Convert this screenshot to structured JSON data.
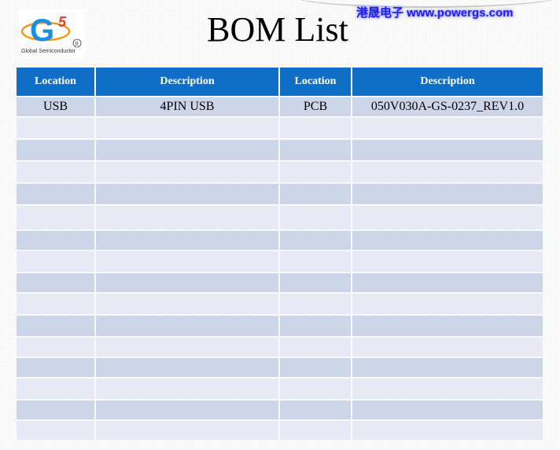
{
  "header": {
    "logo": {
      "mark": "G5",
      "caption": "Global Semiconductor",
      "registered": "®"
    },
    "title": "BOM List",
    "brand_text": "港晟电子 www.powergs.com"
  },
  "table": {
    "columns": [
      "Location",
      "Description",
      "Location",
      "Description"
    ],
    "rows": [
      [
        "USB",
        "4PIN USB",
        "PCB",
        "050V030A-GS-0237_REV1.0"
      ],
      [
        "",
        "",
        "",
        ""
      ],
      [
        "",
        "",
        "",
        ""
      ],
      [
        "",
        "",
        "",
        ""
      ],
      [
        "",
        "",
        "",
        ""
      ],
      [
        "",
        "",
        "",
        ""
      ],
      [
        "",
        "",
        "",
        ""
      ],
      [
        "",
        "",
        "",
        ""
      ],
      [
        "",
        "",
        "",
        ""
      ],
      [
        "",
        "",
        "",
        ""
      ],
      [
        "",
        "",
        "",
        ""
      ],
      [
        "",
        "",
        "",
        ""
      ],
      [
        "",
        "",
        "",
        ""
      ],
      [
        "",
        "",
        "",
        ""
      ],
      [
        "",
        "",
        "",
        ""
      ],
      [
        "",
        "",
        "",
        ""
      ]
    ]
  },
  "colors": {
    "header_bg": "#0f6fc6",
    "row_odd": "#cdd5e9",
    "row_even": "#e7eaf5",
    "brand": "#1a1aff"
  }
}
